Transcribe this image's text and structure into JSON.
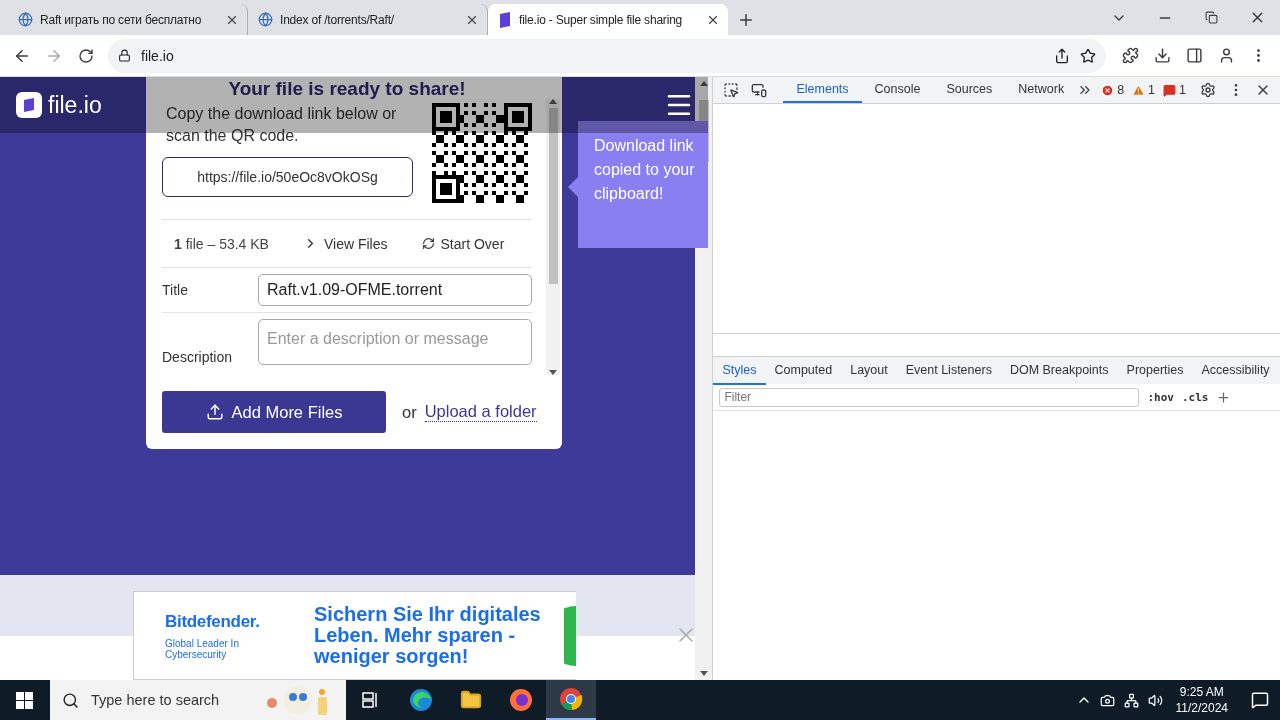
{
  "browser_tabs": [
    {
      "title": "Raft играть по сети бесплатно",
      "selected": false
    },
    {
      "title": "Index of /torrents/Raft/",
      "selected": false
    },
    {
      "title": "file.io - Super simple file sharing",
      "selected": true
    }
  ],
  "address": "file.io",
  "site": {
    "logo": "file.io",
    "modal": {
      "heading": "Your file is ready to share!",
      "instructions": "Copy the download link below or scan the QR code.",
      "link": "https://file.io/50eOc8vOkOSg",
      "summary": "**1** file – 53.4 KB",
      "view_files": "View Files",
      "start_over": "Start Over",
      "fields": [
        {
          "kind": "text",
          "label": "Title",
          "value": "Raft.v1.09-OFME.torrent"
        },
        {
          "kind": "textarea",
          "label": "Description",
          "placeholder": "Enter a description or message"
        }
      ],
      "add_button": "Add More Files",
      "or": "or",
      "upload_folder": "Upload a folder"
    },
    "tooltip": "Download link copied to your clipboard!"
  },
  "ad": {
    "brand": "Bitdefender.",
    "tagline": "Global Leader In Cybersecurity",
    "headline": "Sichern Sie Ihr digitales Leben. Mehr sparen - weniger sorgen!"
  },
  "devtools": {
    "tabs": [
      {
        "label": "Elements",
        "selected": true
      },
      {
        "label": "Console",
        "selected": false
      },
      {
        "label": "Sources",
        "selected": false
      },
      {
        "label": "Network",
        "selected": false
      }
    ],
    "errors": "8",
    "warnings": "1",
    "issues": "1",
    "panel_tabs": [
      {
        "label": "Styles",
        "selected": true
      },
      {
        "label": "Computed",
        "selected": false
      },
      {
        "label": "Layout",
        "selected": false
      },
      {
        "label": "Event Listeners",
        "selected": false
      },
      {
        "label": "DOM Breakpoints",
        "selected": false
      },
      {
        "label": "Properties",
        "selected": false
      },
      {
        "label": "Accessibility",
        "selected": false
      }
    ],
    "filter": {
      "placeholder": "Filter"
    },
    "hov": ":hov",
    "cls": ".cls"
  },
  "taskbar": {
    "search": {
      "placeholder": "Type here to search"
    },
    "time": "9:25 AM",
    "date": "11/2/2024"
  }
}
